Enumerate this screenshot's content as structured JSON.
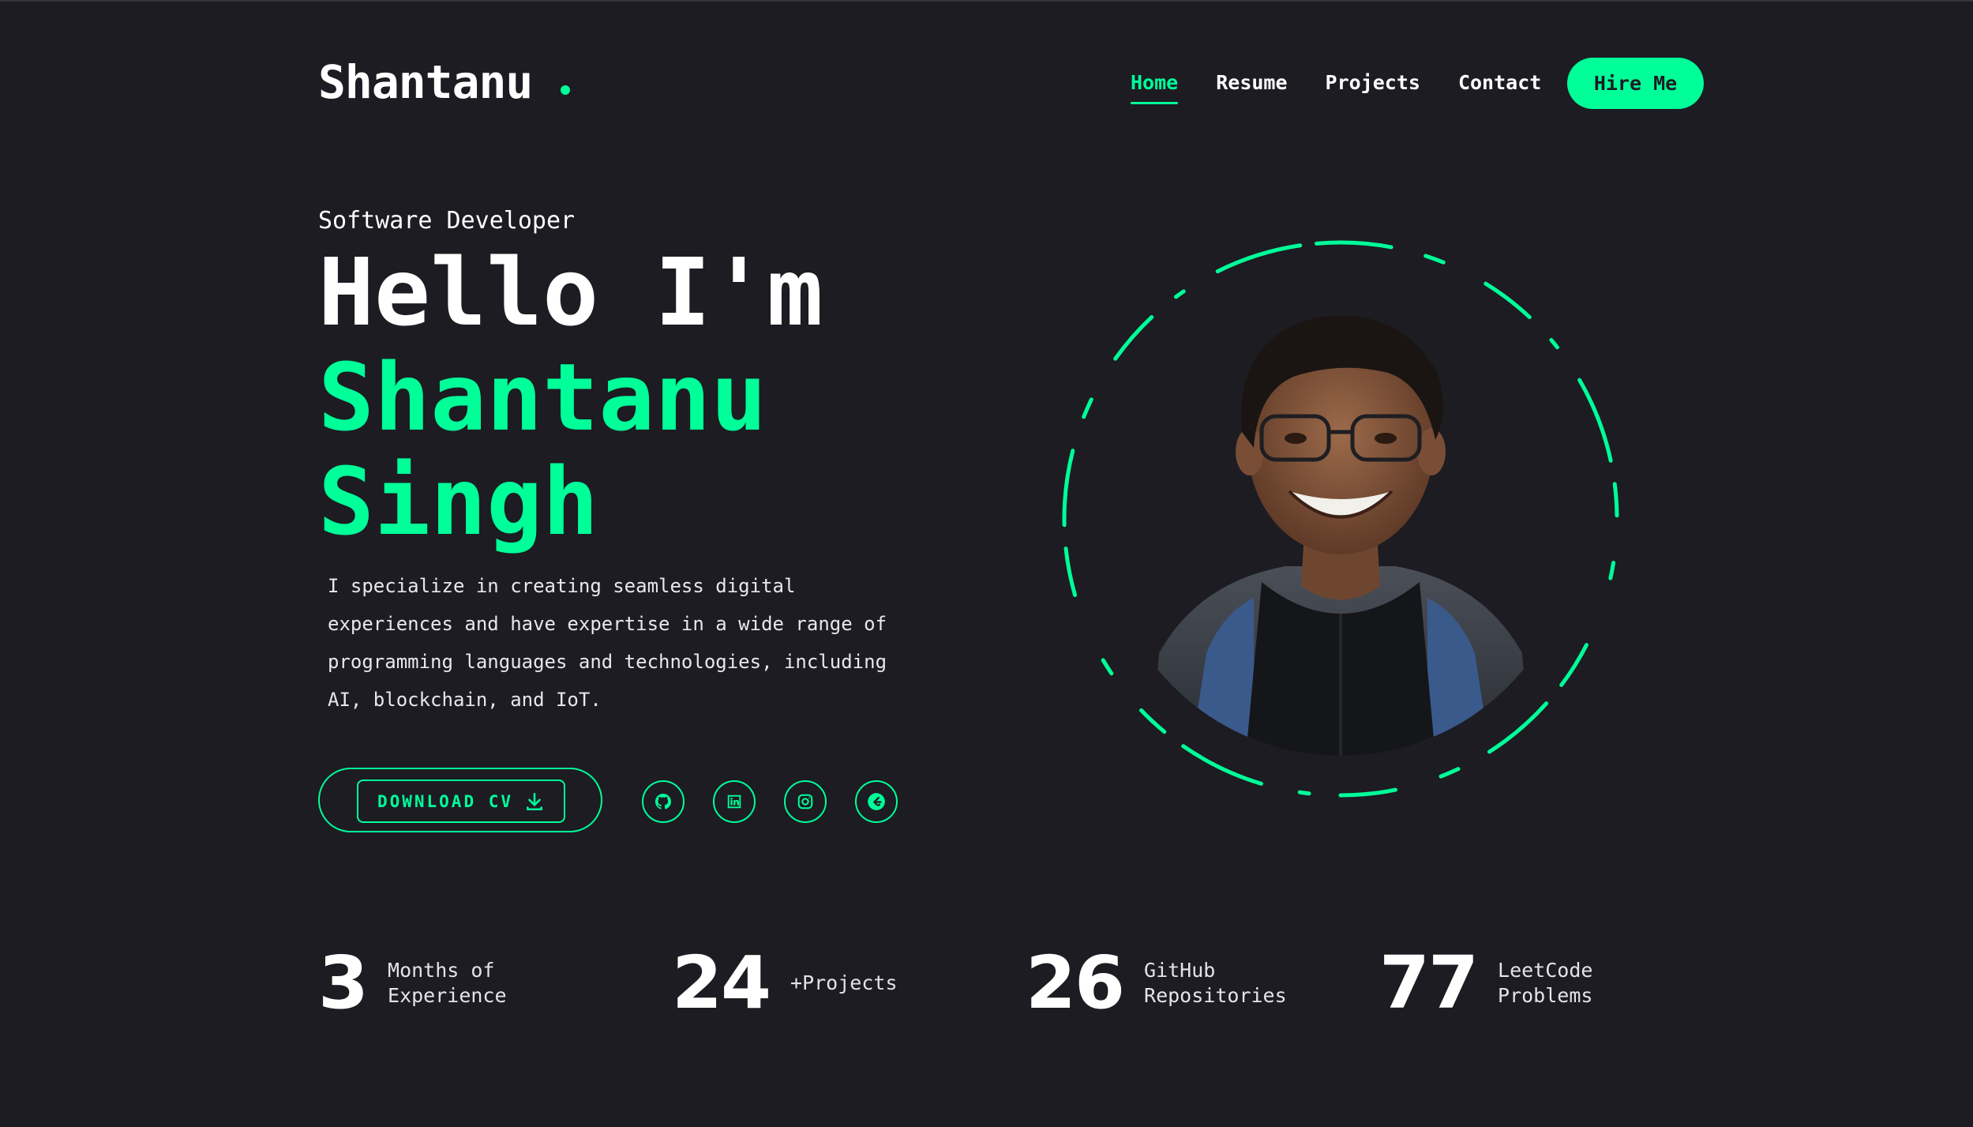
{
  "colors": {
    "background": "#1c1c22",
    "accent": "#00ff99",
    "text": "#ffffff"
  },
  "header": {
    "logo": "Shantanu",
    "nav": [
      "Home",
      "Resume",
      "Projects",
      "Contact"
    ],
    "active_nav": "Home",
    "hire_label": "Hire Me"
  },
  "hero": {
    "role": "Software Developer",
    "greeting": "Hello I'm",
    "name_line1": "Shantanu",
    "name_line2": "Singh",
    "description": "I specialize in creating seamless digital experiences and have expertise in a wide range of programming languages and technologies, including AI, blockchain, and IoT.",
    "download_label": "DOWNLOAD CV",
    "socials": [
      "github-icon",
      "linkedin-icon",
      "instagram-icon",
      "leetcode-icon"
    ]
  },
  "stats": [
    {
      "value": "3",
      "label": "Months of\nExperience"
    },
    {
      "value": "24",
      "label": "+Projects"
    },
    {
      "value": "26",
      "label": "GitHub\nRepositories"
    },
    {
      "value": "77",
      "label": "LeetCode\nProblems"
    }
  ]
}
